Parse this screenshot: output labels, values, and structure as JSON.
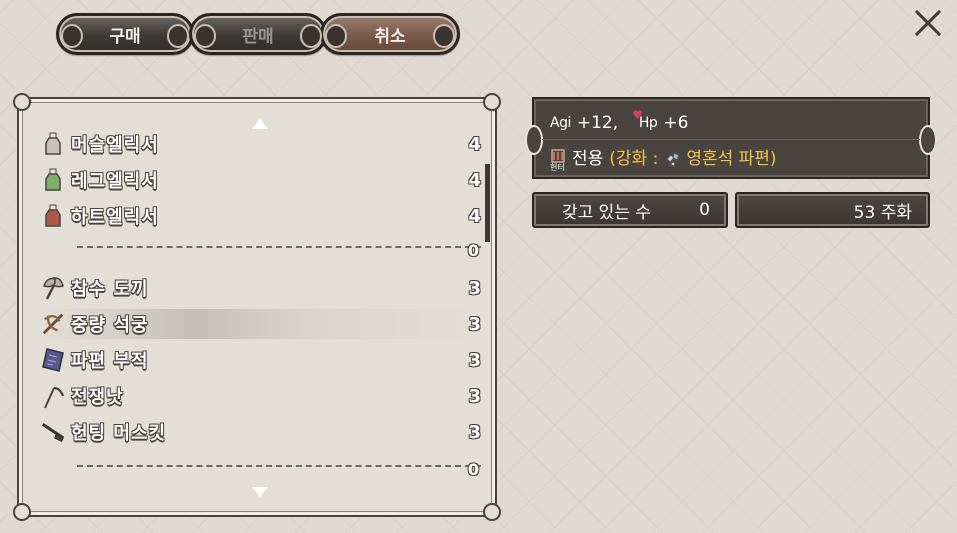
{
  "tabs": {
    "buy": "구매",
    "sell": "판매",
    "cancel": "취소"
  },
  "close_label": "✕",
  "list": {
    "groups": [
      {
        "items": [
          {
            "name": "머슬엘릭서",
            "qty": "4",
            "icon": "potion-bottle-icon",
            "color": "#c9c3b5"
          },
          {
            "name": "레그엘릭서",
            "qty": "4",
            "icon": "potion-bottle-icon",
            "color": "#7fb06a"
          },
          {
            "name": "하트엘릭서",
            "qty": "4",
            "icon": "potion-bottle-icon",
            "color": "#b3564a"
          }
        ],
        "separator_count": "0"
      },
      {
        "items": [
          {
            "name": "참수 도끼",
            "qty": "3",
            "icon": "axe-icon"
          },
          {
            "name": "중량 석궁",
            "qty": "3",
            "icon": "crossbow-icon",
            "selected": true
          },
          {
            "name": "파편 부적",
            "qty": "3",
            "icon": "talisman-icon"
          },
          {
            "name": "전쟁낫",
            "qty": "3",
            "icon": "scythe-icon"
          },
          {
            "name": "헌팅 머스킷",
            "qty": "3",
            "icon": "musket-icon"
          }
        ],
        "separator_count": "0"
      }
    ]
  },
  "info": {
    "stat1_tag": "Agi",
    "stat1_value": "+12,",
    "stat2_tag": "Hp",
    "stat2_value": "+6",
    "class_tag": "헌터",
    "exclusive": "전용",
    "enhance_prefix": "(강화 :",
    "enhance_item": "영혼석 파편)"
  },
  "owned": {
    "label": "갖고 있는 수",
    "value": "0"
  },
  "money": {
    "value": "53 주화"
  },
  "colors": {
    "accent_yellow": "#f0c64a",
    "panel_dark": "#4a4440",
    "tab_active": "#7a5a4b"
  }
}
